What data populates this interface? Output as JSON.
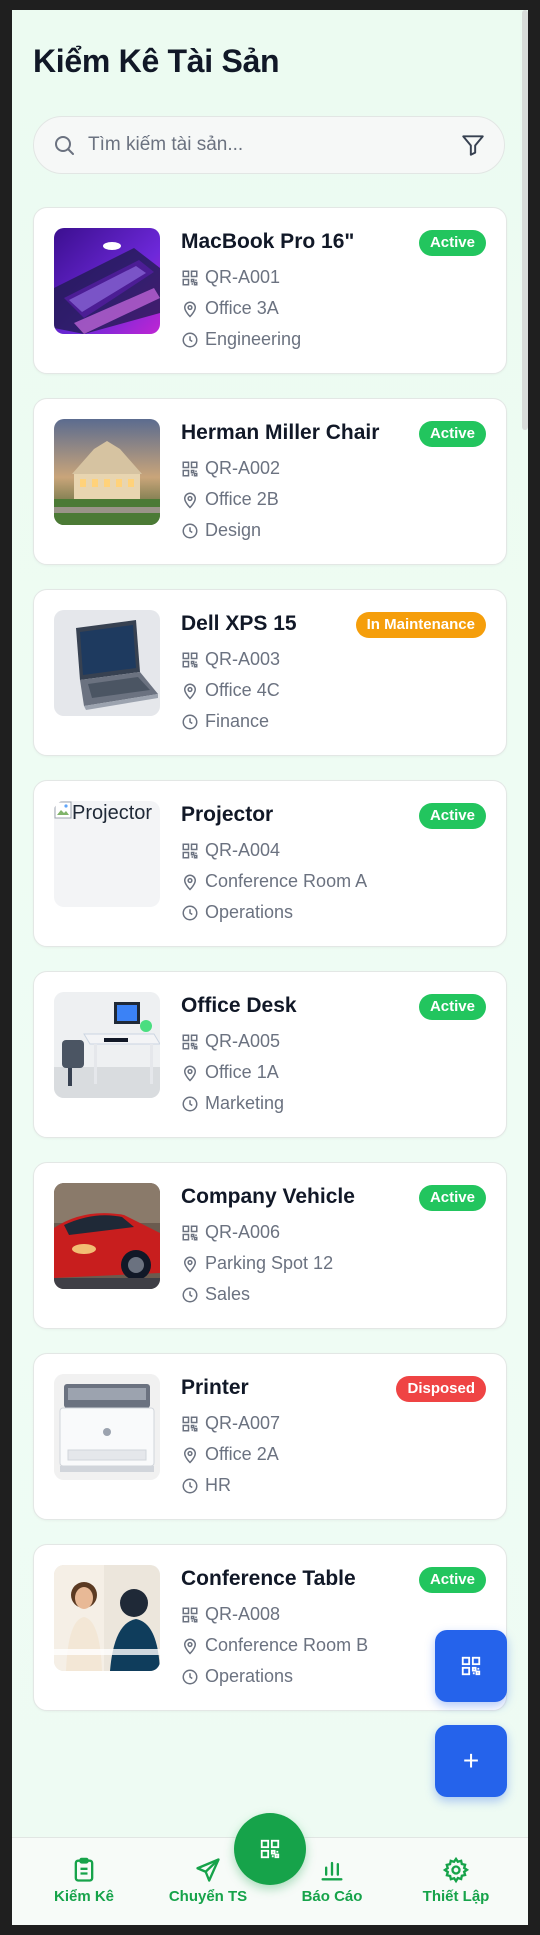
{
  "page_title": "Kiểm Kê Tài Sản",
  "search": {
    "placeholder": "Tìm kiếm tài sản..."
  },
  "assets": [
    {
      "name": "MacBook Pro 16\"",
      "code": "QR-A001",
      "location": "Office 3A",
      "department": "Engineering",
      "status": "Active",
      "status_color": "#22c55e"
    },
    {
      "name": "Herman Miller Chair",
      "code": "QR-A002",
      "location": "Office 2B",
      "department": "Design",
      "status": "Active",
      "status_color": "#22c55e"
    },
    {
      "name": "Dell XPS 15",
      "code": "QR-A003",
      "location": "Office 4C",
      "department": "Finance",
      "status": "In Maintenance",
      "status_color": "#f59e0b"
    },
    {
      "name": "Projector",
      "code": "QR-A004",
      "location": "Conference Room A",
      "department": "Operations",
      "status": "Active",
      "status_color": "#22c55e",
      "image_alt": "Projector"
    },
    {
      "name": "Office Desk",
      "code": "QR-A005",
      "location": "Office 1A",
      "department": "Marketing",
      "status": "Active",
      "status_color": "#22c55e"
    },
    {
      "name": "Company Vehicle",
      "code": "QR-A006",
      "location": "Parking Spot 12",
      "department": "Sales",
      "status": "Active",
      "status_color": "#22c55e"
    },
    {
      "name": "Printer",
      "code": "QR-A007",
      "location": "Office 2A",
      "department": "HR",
      "status": "Disposed",
      "status_color": "#ef4444"
    },
    {
      "name": "Conference Table",
      "code": "QR-A008",
      "location": "Conference Room B",
      "department": "Operations",
      "status": "Active",
      "status_color": "#22c55e"
    }
  ],
  "fab": {
    "scan_icon": "qr-scan-icon",
    "add_icon": "plus-icon",
    "add_label": "+"
  },
  "bottom_nav": {
    "items": [
      {
        "label": "Kiểm Kê",
        "icon": "clipboard-icon"
      },
      {
        "label": "Chuyển TS",
        "icon": "send-icon"
      },
      {
        "label": "Báo Cáo",
        "icon": "bar-chart-icon"
      },
      {
        "label": "Thiết Lập",
        "icon": "gear-icon"
      }
    ],
    "center_icon": "qr-scan-icon"
  },
  "colors": {
    "primary_green": "#16a34a",
    "primary_blue": "#2563eb",
    "active": "#22c55e",
    "maintenance": "#f59e0b",
    "disposed": "#ef4444"
  }
}
